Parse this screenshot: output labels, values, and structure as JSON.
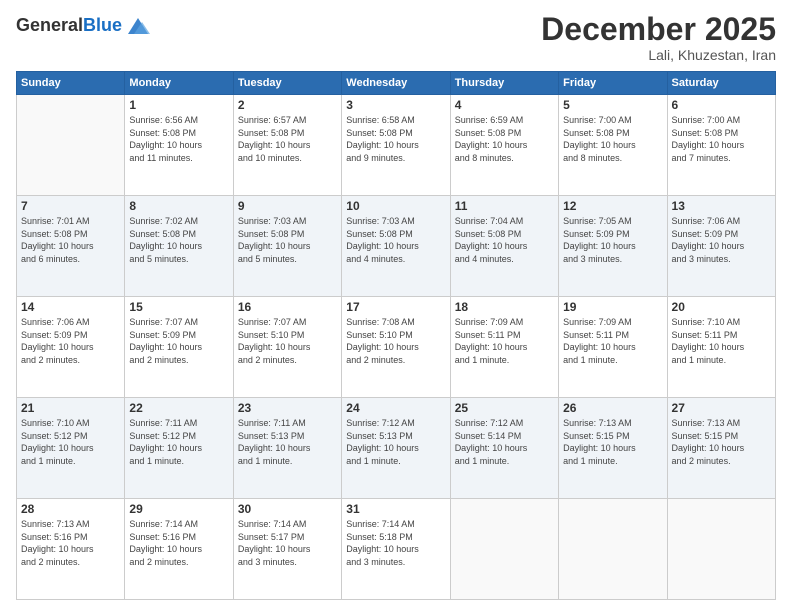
{
  "header": {
    "logo_general": "General",
    "logo_blue": "Blue",
    "month": "December 2025",
    "location": "Lali, Khuzestan, Iran"
  },
  "weekdays": [
    "Sunday",
    "Monday",
    "Tuesday",
    "Wednesday",
    "Thursday",
    "Friday",
    "Saturday"
  ],
  "weeks": [
    [
      {
        "day": "",
        "info": ""
      },
      {
        "day": "1",
        "info": "Sunrise: 6:56 AM\nSunset: 5:08 PM\nDaylight: 10 hours\nand 11 minutes."
      },
      {
        "day": "2",
        "info": "Sunrise: 6:57 AM\nSunset: 5:08 PM\nDaylight: 10 hours\nand 10 minutes."
      },
      {
        "day": "3",
        "info": "Sunrise: 6:58 AM\nSunset: 5:08 PM\nDaylight: 10 hours\nand 9 minutes."
      },
      {
        "day": "4",
        "info": "Sunrise: 6:59 AM\nSunset: 5:08 PM\nDaylight: 10 hours\nand 8 minutes."
      },
      {
        "day": "5",
        "info": "Sunrise: 7:00 AM\nSunset: 5:08 PM\nDaylight: 10 hours\nand 8 minutes."
      },
      {
        "day": "6",
        "info": "Sunrise: 7:00 AM\nSunset: 5:08 PM\nDaylight: 10 hours\nand 7 minutes."
      }
    ],
    [
      {
        "day": "7",
        "info": "Sunrise: 7:01 AM\nSunset: 5:08 PM\nDaylight: 10 hours\nand 6 minutes."
      },
      {
        "day": "8",
        "info": "Sunrise: 7:02 AM\nSunset: 5:08 PM\nDaylight: 10 hours\nand 5 minutes."
      },
      {
        "day": "9",
        "info": "Sunrise: 7:03 AM\nSunset: 5:08 PM\nDaylight: 10 hours\nand 5 minutes."
      },
      {
        "day": "10",
        "info": "Sunrise: 7:03 AM\nSunset: 5:08 PM\nDaylight: 10 hours\nand 4 minutes."
      },
      {
        "day": "11",
        "info": "Sunrise: 7:04 AM\nSunset: 5:08 PM\nDaylight: 10 hours\nand 4 minutes."
      },
      {
        "day": "12",
        "info": "Sunrise: 7:05 AM\nSunset: 5:09 PM\nDaylight: 10 hours\nand 3 minutes."
      },
      {
        "day": "13",
        "info": "Sunrise: 7:06 AM\nSunset: 5:09 PM\nDaylight: 10 hours\nand 3 minutes."
      }
    ],
    [
      {
        "day": "14",
        "info": "Sunrise: 7:06 AM\nSunset: 5:09 PM\nDaylight: 10 hours\nand 2 minutes."
      },
      {
        "day": "15",
        "info": "Sunrise: 7:07 AM\nSunset: 5:09 PM\nDaylight: 10 hours\nand 2 minutes."
      },
      {
        "day": "16",
        "info": "Sunrise: 7:07 AM\nSunset: 5:10 PM\nDaylight: 10 hours\nand 2 minutes."
      },
      {
        "day": "17",
        "info": "Sunrise: 7:08 AM\nSunset: 5:10 PM\nDaylight: 10 hours\nand 2 minutes."
      },
      {
        "day": "18",
        "info": "Sunrise: 7:09 AM\nSunset: 5:11 PM\nDaylight: 10 hours\nand 1 minute."
      },
      {
        "day": "19",
        "info": "Sunrise: 7:09 AM\nSunset: 5:11 PM\nDaylight: 10 hours\nand 1 minute."
      },
      {
        "day": "20",
        "info": "Sunrise: 7:10 AM\nSunset: 5:11 PM\nDaylight: 10 hours\nand 1 minute."
      }
    ],
    [
      {
        "day": "21",
        "info": "Sunrise: 7:10 AM\nSunset: 5:12 PM\nDaylight: 10 hours\nand 1 minute."
      },
      {
        "day": "22",
        "info": "Sunrise: 7:11 AM\nSunset: 5:12 PM\nDaylight: 10 hours\nand 1 minute."
      },
      {
        "day": "23",
        "info": "Sunrise: 7:11 AM\nSunset: 5:13 PM\nDaylight: 10 hours\nand 1 minute."
      },
      {
        "day": "24",
        "info": "Sunrise: 7:12 AM\nSunset: 5:13 PM\nDaylight: 10 hours\nand 1 minute."
      },
      {
        "day": "25",
        "info": "Sunrise: 7:12 AM\nSunset: 5:14 PM\nDaylight: 10 hours\nand 1 minute."
      },
      {
        "day": "26",
        "info": "Sunrise: 7:13 AM\nSunset: 5:15 PM\nDaylight: 10 hours\nand 1 minute."
      },
      {
        "day": "27",
        "info": "Sunrise: 7:13 AM\nSunset: 5:15 PM\nDaylight: 10 hours\nand 2 minutes."
      }
    ],
    [
      {
        "day": "28",
        "info": "Sunrise: 7:13 AM\nSunset: 5:16 PM\nDaylight: 10 hours\nand 2 minutes."
      },
      {
        "day": "29",
        "info": "Sunrise: 7:14 AM\nSunset: 5:16 PM\nDaylight: 10 hours\nand 2 minutes."
      },
      {
        "day": "30",
        "info": "Sunrise: 7:14 AM\nSunset: 5:17 PM\nDaylight: 10 hours\nand 3 minutes."
      },
      {
        "day": "31",
        "info": "Sunrise: 7:14 AM\nSunset: 5:18 PM\nDaylight: 10 hours\nand 3 minutes."
      },
      {
        "day": "",
        "info": ""
      },
      {
        "day": "",
        "info": ""
      },
      {
        "day": "",
        "info": ""
      }
    ]
  ]
}
